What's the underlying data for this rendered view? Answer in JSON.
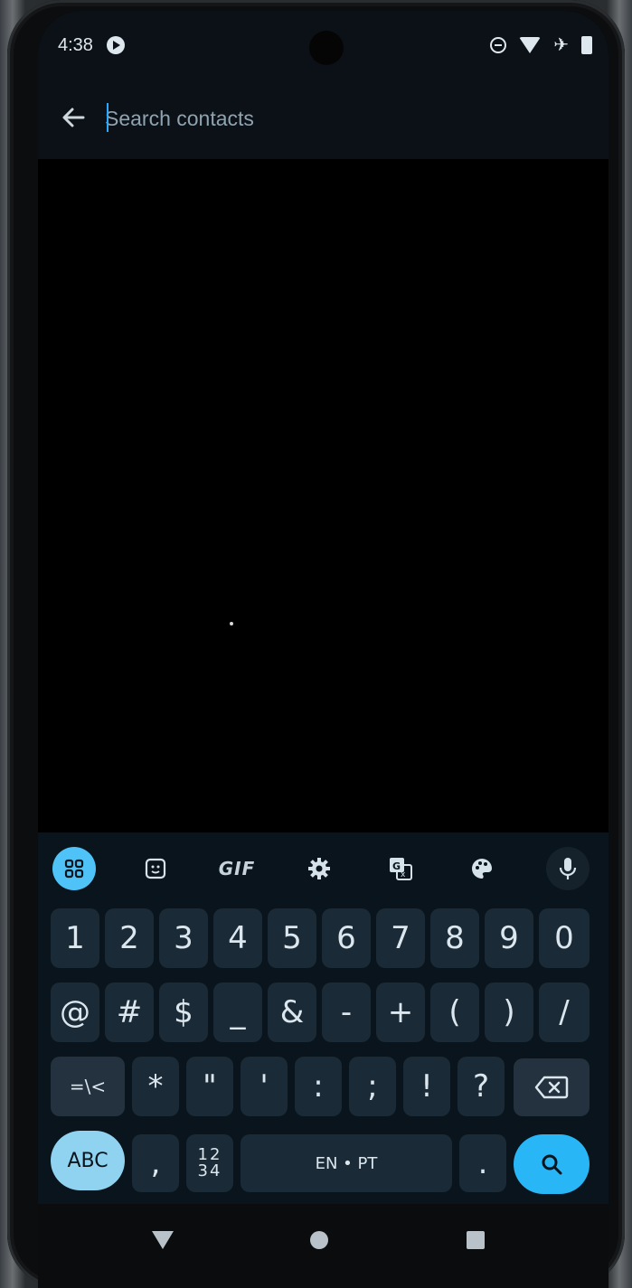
{
  "status_bar": {
    "time": "4:38",
    "icons": [
      "media-icon",
      "do-not-disturb-icon",
      "wifi-icon",
      "airplane-mode-icon",
      "battery-icon"
    ]
  },
  "search": {
    "placeholder": "Search contacts",
    "value": ""
  },
  "keyboard": {
    "toolbar": {
      "gif_label": "GIF",
      "icons": [
        "apps-grid-icon",
        "sticker-icon",
        "gif-icon",
        "settings-icon",
        "translate-icon",
        "palette-icon",
        "mic-icon"
      ]
    },
    "rows": {
      "row1": [
        "1",
        "2",
        "3",
        "4",
        "5",
        "6",
        "7",
        "8",
        "9",
        "0"
      ],
      "row2": [
        "@",
        "#",
        "$",
        "_",
        "&",
        "-",
        "+",
        "(",
        ")",
        "/"
      ],
      "row3": [
        "=\\<",
        "*",
        "\"",
        "'",
        ":",
        ";",
        "!",
        "?"
      ],
      "row4": {
        "abc": "ABC",
        "comma": ",",
        "numpad": "12\n34",
        "space": "EN • PT",
        "period": "."
      }
    },
    "accent_color": "#29b6f6"
  },
  "navbar": {
    "icons": [
      "back-icon",
      "home-icon",
      "recents-icon"
    ]
  }
}
